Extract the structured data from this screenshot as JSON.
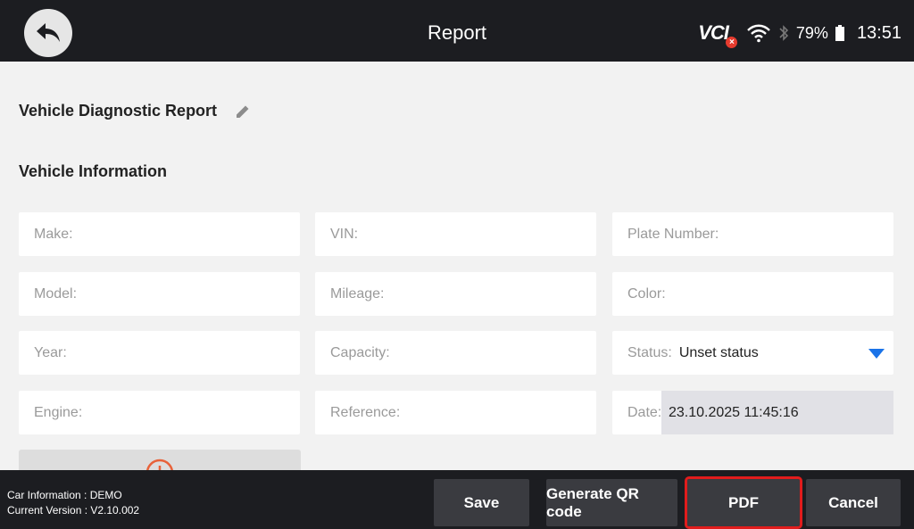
{
  "header": {
    "title": "Report",
    "vci_label": "VCI",
    "battery_percent": "79%",
    "clock": "13:51"
  },
  "report": {
    "title": "Vehicle Diagnostic Report",
    "section_title": "Vehicle Information"
  },
  "fields": {
    "make": "Make:",
    "vin": "VIN:",
    "plate": "Plate Number:",
    "model": "Model:",
    "mileage": "Mileage:",
    "color": "Color:",
    "year": "Year:",
    "capacity": "Capacity:",
    "status_label": "Status:",
    "status_value": "Unset status",
    "engine": "Engine:",
    "reference": "Reference:",
    "date_label": "Date:",
    "date_value": "23.10.2025 11:45:16"
  },
  "footer": {
    "car_info": "Car Information : DEMO",
    "version": "Current Version : V2.10.002",
    "save": "Save",
    "qr": "Generate QR code",
    "pdf": "PDF",
    "cancel": "Cancel"
  },
  "colors": {
    "bar": "#1c1d21",
    "accent_blue": "#1a73e8",
    "highlight_red": "#e11c1c",
    "warning_orange": "#e8623a"
  }
}
